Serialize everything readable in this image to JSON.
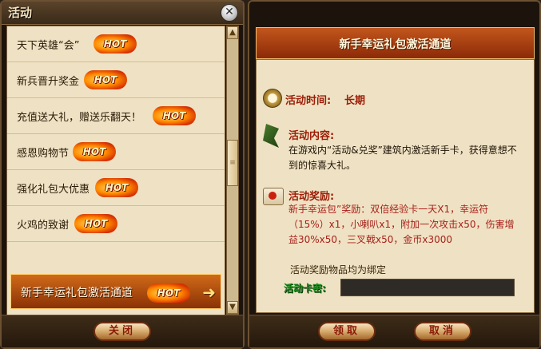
{
  "left_panel": {
    "title": "活动",
    "close_glyph": "✕",
    "items": [
      {
        "label": "天下英雄“会”",
        "badge": "HOT"
      },
      {
        "label": "新兵晋升奖金",
        "badge": "HOT"
      },
      {
        "label": "充值送大礼，赠送乐翻天！",
        "badge": "HOT"
      },
      {
        "label": "感恩购物节",
        "badge": "HOT"
      },
      {
        "label": "强化礼包大优惠",
        "badge": "HOT"
      },
      {
        "label": "火鸡的致谢",
        "badge": "HOT"
      },
      {
        "label": "新手幸运礼包激活通道",
        "badge": "HOT",
        "active": true
      }
    ],
    "scroll_up_glyph": "▲",
    "scroll_down_glyph": "▼",
    "scroll_thumb_glyph": "≡",
    "close_button_label": "关闭"
  },
  "right_panel": {
    "banner_title": "新手幸运礼包激活通道",
    "time": {
      "label": "活动时间:",
      "value": "长期"
    },
    "content": {
      "label": "活动内容:",
      "text": "在游戏内“活动&兑奖”建筑内激活新手卡，获得意想不到的惊喜大礼。"
    },
    "reward": {
      "label": "活动奖励:",
      "text": "新手幸运包”奖励：双倍经验卡一天X1，幸运符（15%）x1，小喇叭x1，附加一次攻击x50，伤害增益30%x50，三叉戟x50，金币x3000"
    },
    "binding_note": "活动奖励物品均为绑定",
    "card_label": "活动卡密:",
    "card_value": "",
    "claim_button_label": "领取",
    "cancel_button_label": "取消"
  },
  "colors": {
    "accent_red": "#9c1c06",
    "panel_bg": "#efe2c4",
    "active_item": "#d06a18"
  },
  "icons": {
    "time": "stopwatch-icon",
    "content": "flag-icon",
    "reward": "reward-scroll-icon",
    "active_arrow": "arrow-right-icon"
  }
}
